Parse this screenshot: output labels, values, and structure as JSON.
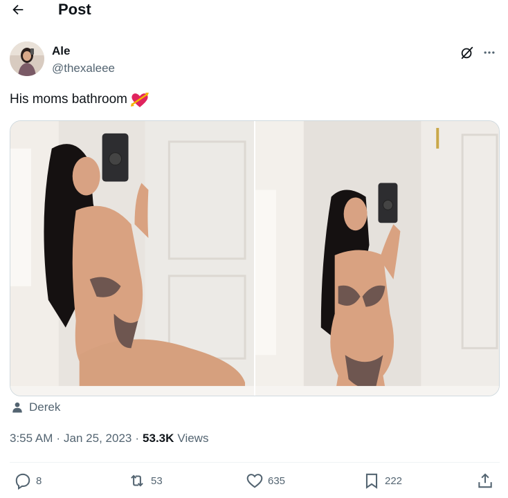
{
  "header": {
    "title": "Post"
  },
  "author": {
    "name": "Ale",
    "handle": "@thexaleee"
  },
  "post": {
    "text": "His moms bathroom"
  },
  "tag": {
    "user": "Derek"
  },
  "meta": {
    "time": "3:55 AM",
    "sep1": "·",
    "date": "Jan 25, 2023",
    "sep2": "·",
    "views_count": "53.3K",
    "views_label": "Views"
  },
  "actions": {
    "replies": "8",
    "reposts": "53",
    "likes": "635",
    "bookmarks": "222"
  },
  "icons": [
    "back-arrow-icon",
    "grok-icon",
    "more-icon",
    "heart-arrow-emoji",
    "person-icon",
    "reply-icon",
    "repost-icon",
    "like-icon",
    "bookmark-icon",
    "share-icon"
  ]
}
